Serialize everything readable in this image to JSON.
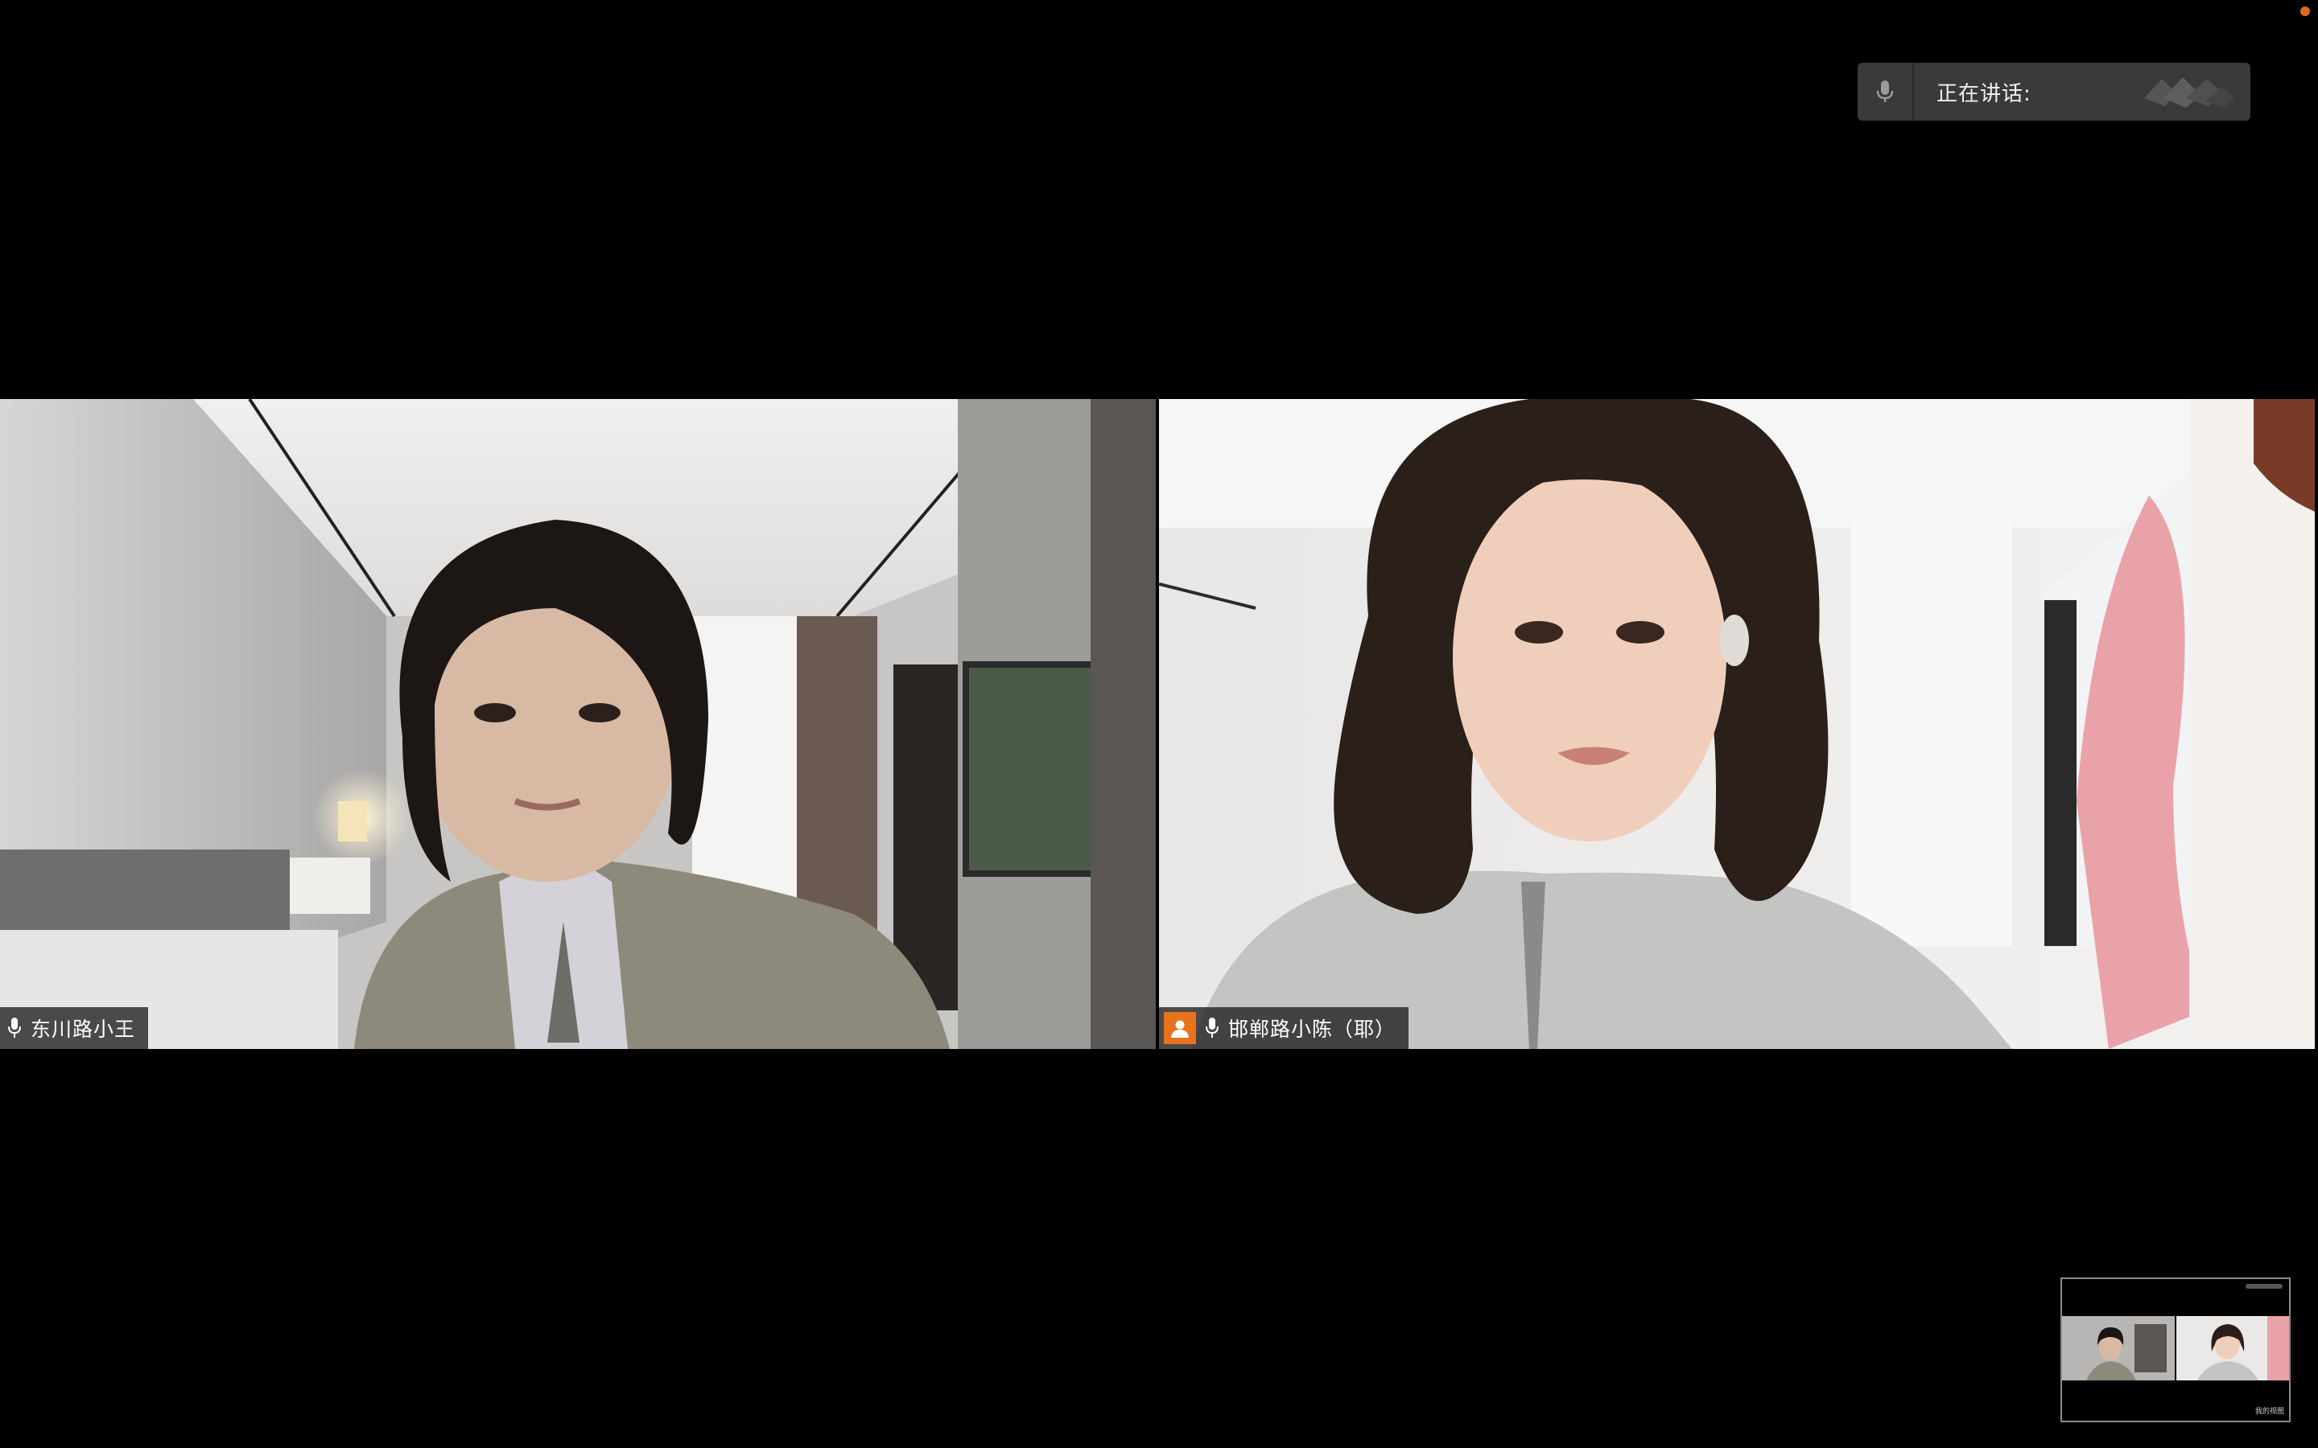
{
  "speaking": {
    "label": "正在讲话:"
  },
  "participants": [
    {
      "name": "东川路小王",
      "mic_state": "on"
    },
    {
      "name": "邯郸路小陈（耶）",
      "mic_state": "on",
      "has_avatar_badge": true
    }
  ],
  "self_view": {
    "caption": "我的视图"
  },
  "colors": {
    "background": "#000000",
    "accent": "#e8731c",
    "status_dot": "#e06a1b",
    "panel": "#3a3a3c"
  },
  "icons": [
    "mic-icon",
    "person-icon",
    "speaker-waves-icon"
  ]
}
